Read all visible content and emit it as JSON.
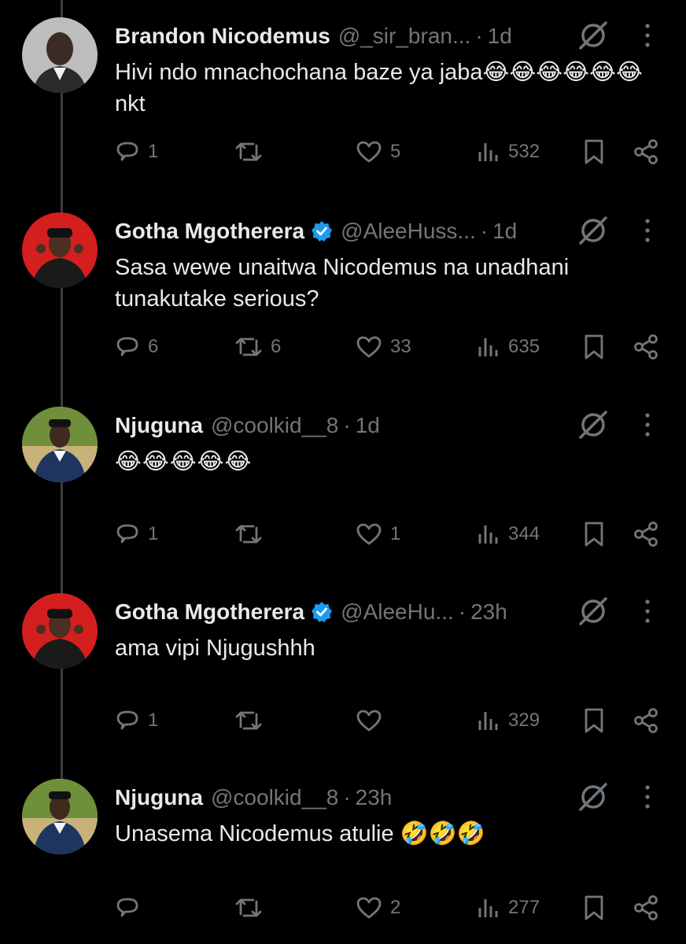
{
  "colors": {
    "background": "#000000",
    "text": "#e7e9ea",
    "muted": "#71767b",
    "verified": "#1d9bf0"
  },
  "tweets": [
    {
      "name": "Brandon Nicodemus",
      "handle": "@_sir_bran...",
      "sep": "·",
      "time": "1d",
      "verified": false,
      "text": "Hivi ndo mnachochana baze ya jaba😂😂😂😂😂😂nkt",
      "replies": "1",
      "reposts": "",
      "likes": "5",
      "views": "532"
    },
    {
      "name": "Gotha Mgotherera",
      "handle": "@AleeHuss...",
      "sep": "·",
      "time": "1d",
      "verified": true,
      "text": "Sasa wewe unaitwa Nicodemus na unadhani tunakutake serious?",
      "replies": "6",
      "reposts": "6",
      "likes": "33",
      "views": "635"
    },
    {
      "name": "Njuguna",
      "handle": "@coolkid__8",
      "sep": "·",
      "time": "1d",
      "verified": false,
      "text": "😂😂😂😂😂",
      "replies": "1",
      "reposts": "",
      "likes": "1",
      "views": "344"
    },
    {
      "name": "Gotha Mgotherera",
      "handle": "@AleeHu...",
      "sep": "·",
      "time": "23h",
      "verified": true,
      "text": "ama vipi Njugushhh",
      "replies": "1",
      "reposts": "",
      "likes": "",
      "views": "329"
    },
    {
      "name": "Njuguna",
      "handle": "@coolkid__8",
      "sep": "·",
      "time": "23h",
      "verified": false,
      "text": "Unasema Nicodemus atulie 🤣🤣🤣",
      "replies": "",
      "reposts": "",
      "likes": "2",
      "views": "277"
    }
  ]
}
